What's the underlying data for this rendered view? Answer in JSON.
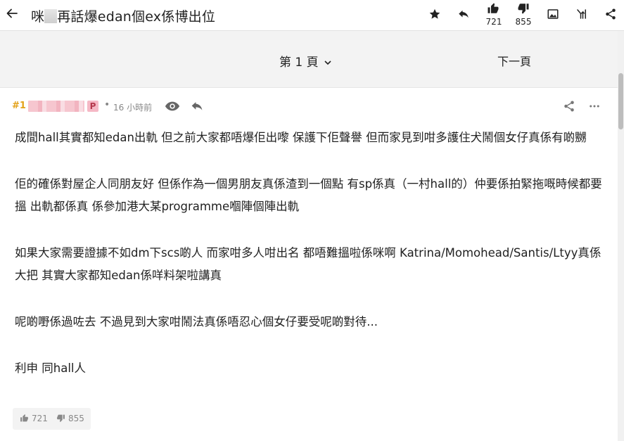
{
  "topbar": {
    "title_prefix": "咪",
    "title_suffix": "再話爆edan個ex係博出位",
    "like_count": "721",
    "dislike_count": "855"
  },
  "pager": {
    "page_label": "第 1 頁",
    "next_label": "下一頁"
  },
  "post": {
    "floor": "#1",
    "badge": "P",
    "dot": "•",
    "time": "16 小時前",
    "paragraphs": [
      "成間hall其實都知edan出軌 但之前大家都唔爆佢出嚟 保護下佢聲譽 但而家見到咁多護住犬鬧個女仔真係有啲嬲",
      "佢的確係對屋企人同朋友好 但係作為一個男朋友真係渣到一個點 有sp係真（一村hall的）仲要係拍緊拖嘅時候都要搵 出軌都係真 係參加港大某programme嗰陣個陣出軌",
      "如果大家需要證據不如dm下scs啲人 而家咁多人咁出名 都唔難搵啦係咪啊 Katrina/Momohead/Santis/Ltyy真係大把 其實大家都知edan係咩料架啦講真",
      "呢啲嘢係過咗去 不過見到大家咁鬧法真係唔忍心個女仔要受呢啲對待...",
      "利申 同hall人"
    ],
    "like_count": "721",
    "dislike_count": "855"
  },
  "colors": {
    "floor": "#e3a21a",
    "badge_bg": "#f5b8c5",
    "pager_bg": "#f3f3f3"
  },
  "icons": [
    "back-arrow-icon",
    "star-icon",
    "reply-icon",
    "thumb-up-icon",
    "thumb-down-icon",
    "image-icon",
    "filter-icon",
    "share-icon",
    "eye-icon",
    "more-icon",
    "chevron-down-icon"
  ]
}
